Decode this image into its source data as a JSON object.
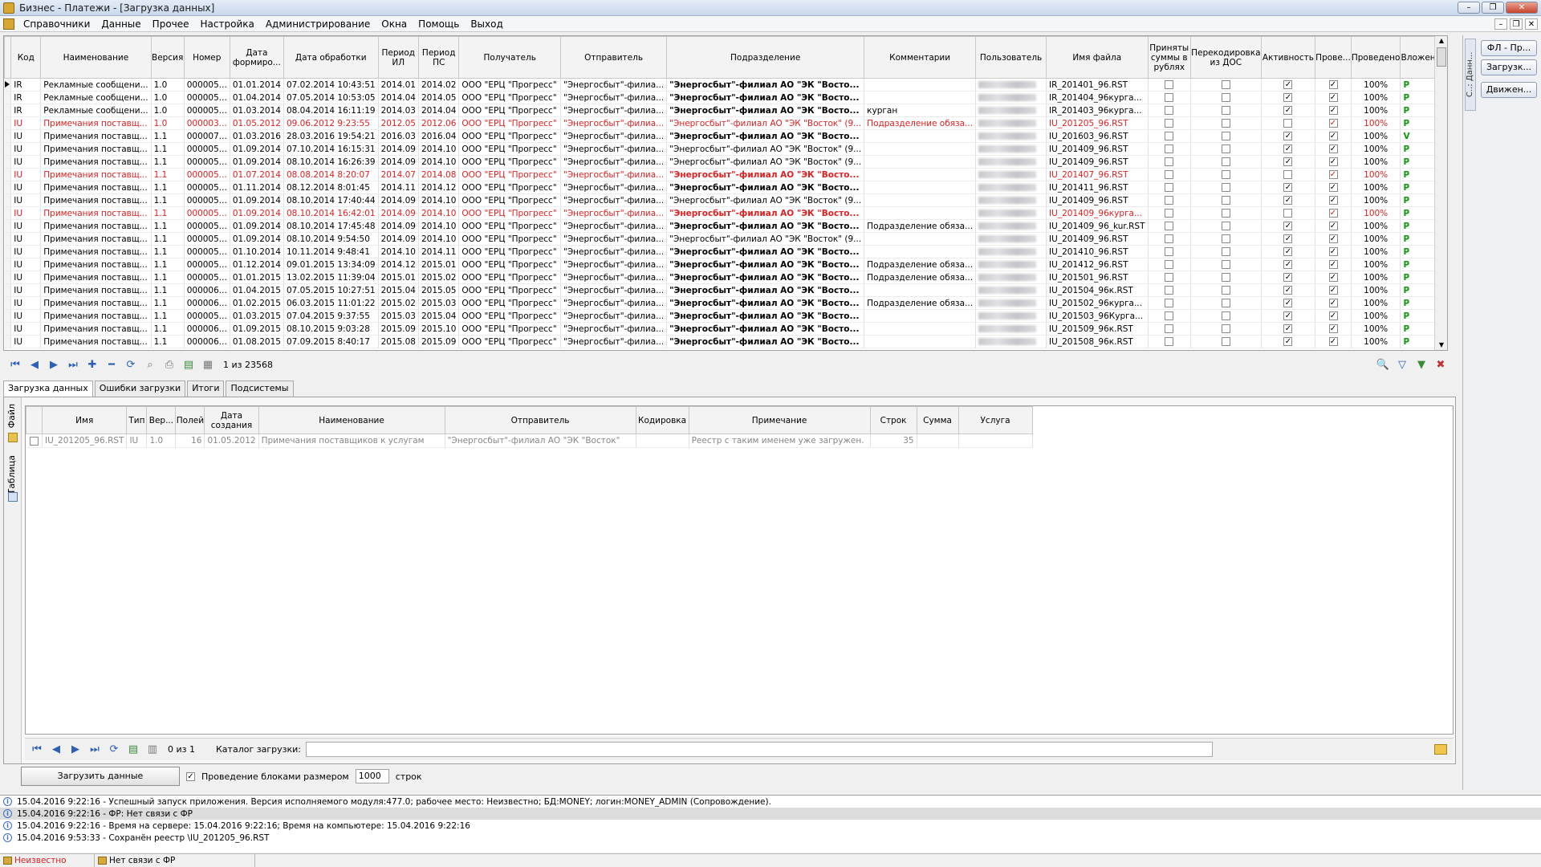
{
  "window": {
    "title": "Бизнес - Платежи - [Загрузка данных]",
    "min": "–",
    "restore": "❐",
    "close": "✕"
  },
  "menu": [
    "Справочники",
    "Данные",
    "Прочее",
    "Настройка",
    "Администрирование",
    "Окна",
    "Помощь",
    "Выход"
  ],
  "main_grid": {
    "columns": [
      "Код",
      "Наименование",
      "Версия",
      "Номер",
      "Дата формиро...",
      "Дата обработки",
      "Период ИЛ",
      "Период ПС",
      "Получатель",
      "Отправитель",
      "Подразделение",
      "Комментарии",
      "Пользователь",
      "Имя файла",
      "Приняты суммы в рублях",
      "Перекодировка из ДОС",
      "Активность",
      "Прове...",
      "Проведено",
      "Вложение"
    ],
    "rows": [
      {
        "red": false,
        "bold": true,
        "cells": [
          "IR",
          "Рекламные сообщени...",
          "1.0",
          "000005...",
          "01.01.2014",
          "07.02.2014 10:43:51",
          "2014.01",
          "2014.02",
          "ООО \"ЕРЦ \"Прогресс\"",
          "\"Энергосбыт\"-филиа...",
          "\"Энергосбыт\"-филиал АО \"ЭК \"Восто...",
          "",
          "",
          "IR_201401_96.RST",
          "✓",
          "✓",
          "100%",
          "P"
        ],
        "act": true
      },
      {
        "red": false,
        "bold": true,
        "cells": [
          "IR",
          "Рекламные сообщени...",
          "1.0",
          "000005...",
          "01.04.2014",
          "07.05.2014 10:53:05",
          "2014.04",
          "2014.05",
          "ООО \"ЕРЦ \"Прогресс\"",
          "\"Энергосбыт\"-филиа...",
          "\"Энергосбыт\"-филиал АО \"ЭК \"Восто...",
          "",
          "",
          "IR_201404_96курга...",
          "✓",
          "✓",
          "100%",
          "P"
        ]
      },
      {
        "red": false,
        "bold": true,
        "cells": [
          "IR",
          "Рекламные сообщени...",
          "1.0",
          "000005...",
          "01.03.2014",
          "08.04.2014 16:11:19",
          "2014.03",
          "2014.04",
          "ООО \"ЕРЦ \"Прогресс\"",
          "\"Энергосбыт\"-филиа...",
          "\"Энергосбыт\"-филиал АО \"ЭК \"Восто...",
          "курган",
          "",
          "IR_201403_96курга...",
          "✓",
          "✓",
          "100%",
          "P"
        ]
      },
      {
        "red": true,
        "bold": false,
        "cells": [
          "IU",
          "Примечания поставщ...",
          "1.0",
          "000003...",
          "01.05.2012",
          "09.06.2012 9:23:55",
          "2012.05",
          "2012.06",
          "ООО \"ЕРЦ \"Прогресс\"",
          "\"Энергосбыт\"-филиа...",
          "\"Энергосбыт\"-филиал АО \"ЭК \"Восток\" (9...",
          "Подразделение обяза...",
          "",
          "IU_201205_96.RST",
          "",
          "✓",
          "100%",
          "P"
        ]
      },
      {
        "red": false,
        "bold": true,
        "cells": [
          "IU",
          "Примечания поставщ...",
          "1.1",
          "000007...",
          "01.03.2016",
          "28.03.2016 19:54:21",
          "2016.03",
          "2016.04",
          "ООО \"ЕРЦ \"Прогресс\"",
          "\"Энергосбыт\"-филиа...",
          "\"Энергосбыт\"-филиал АО \"ЭК \"Восто...",
          "",
          "",
          "IU_201603_96.RST",
          "✓",
          "✓",
          "100%",
          "V"
        ]
      },
      {
        "red": false,
        "bold": false,
        "cells": [
          "IU",
          "Примечания поставщ...",
          "1.1",
          "000005...",
          "01.09.2014",
          "07.10.2014 16:15:31",
          "2014.09",
          "2014.10",
          "ООО \"ЕРЦ \"Прогресс\"",
          "\"Энергосбыт\"-филиа...",
          "\"Энергосбыт\"-филиал АО \"ЭК \"Восток\" (9...",
          "",
          "",
          "IU_201409_96.RST",
          "✓",
          "✓",
          "100%",
          "P"
        ]
      },
      {
        "red": false,
        "bold": false,
        "cells": [
          "IU",
          "Примечания поставщ...",
          "1.1",
          "000005...",
          "01.09.2014",
          "08.10.2014 16:26:39",
          "2014.09",
          "2014.10",
          "ООО \"ЕРЦ \"Прогресс\"",
          "\"Энергосбыт\"-филиа...",
          "\"Энергосбыт\"-филиал АО \"ЭК \"Восток\" (9...",
          "",
          "",
          "IU_201409_96.RST",
          "✓",
          "✓",
          "100%",
          "P"
        ]
      },
      {
        "red": true,
        "bold": true,
        "cells": [
          "IU",
          "Примечания поставщ...",
          "1.1",
          "000005...",
          "01.07.2014",
          "08.08.2014 8:20:07",
          "2014.07",
          "2014.08",
          "ООО \"ЕРЦ \"Прогресс\"",
          "\"Энергосбыт\"-филиа...",
          "\"Энергосбыт\"-филиал АО \"ЭК \"Восто...",
          "",
          "",
          "IU_201407_96.RST",
          "",
          "✓",
          "100%",
          "P"
        ]
      },
      {
        "red": false,
        "bold": true,
        "cells": [
          "IU",
          "Примечания поставщ...",
          "1.1",
          "000005...",
          "01.11.2014",
          "08.12.2014 8:01:45",
          "2014.11",
          "2014.12",
          "ООО \"ЕРЦ \"Прогресс\"",
          "\"Энергосбыт\"-филиа...",
          "\"Энергосбыт\"-филиал АО \"ЭК \"Восто...",
          "",
          "",
          "IU_201411_96.RST",
          "✓",
          "✓",
          "100%",
          "P"
        ]
      },
      {
        "red": false,
        "bold": false,
        "cells": [
          "IU",
          "Примечания поставщ...",
          "1.1",
          "000005...",
          "01.09.2014",
          "08.10.2014 17:40:44",
          "2014.09",
          "2014.10",
          "ООО \"ЕРЦ \"Прогресс\"",
          "\"Энергосбыт\"-филиа...",
          "\"Энергосбыт\"-филиал АО \"ЭК \"Восток\" (9...",
          "",
          "",
          "IU_201409_96.RST",
          "✓",
          "✓",
          "100%",
          "P"
        ]
      },
      {
        "red": true,
        "bold": true,
        "cells": [
          "IU",
          "Примечания поставщ...",
          "1.1",
          "000005...",
          "01.09.2014",
          "08.10.2014 16:42:01",
          "2014.09",
          "2014.10",
          "ООО \"ЕРЦ \"Прогресс\"",
          "\"Энергосбыт\"-филиа...",
          "\"Энергосбыт\"-филиал АО \"ЭК \"Восто...",
          "",
          "",
          "IU_201409_96курга...",
          "",
          "✓",
          "100%",
          "P"
        ]
      },
      {
        "red": false,
        "bold": true,
        "cells": [
          "IU",
          "Примечания поставщ...",
          "1.1",
          "000005...",
          "01.09.2014",
          "08.10.2014 17:45:48",
          "2014.09",
          "2014.10",
          "ООО \"ЕРЦ \"Прогресс\"",
          "\"Энергосбыт\"-филиа...",
          "\"Энергосбыт\"-филиал АО \"ЭК \"Восто...",
          "Подразделение обяза...",
          "",
          "IU_201409_96_kur.RST",
          "✓",
          "✓",
          "100%",
          "P"
        ]
      },
      {
        "red": false,
        "bold": false,
        "cells": [
          "IU",
          "Примечания поставщ...",
          "1.1",
          "000005...",
          "01.09.2014",
          "08.10.2014 9:54:50",
          "2014.09",
          "2014.10",
          "ООО \"ЕРЦ \"Прогресс\"",
          "\"Энергосбыт\"-филиа...",
          "\"Энергосбыт\"-филиал АО \"ЭК \"Восток\" (9...",
          "",
          "",
          "IU_201409_96.RST",
          "✓",
          "✓",
          "100%",
          "P"
        ]
      },
      {
        "red": false,
        "bold": true,
        "cells": [
          "IU",
          "Примечания поставщ...",
          "1.1",
          "000005...",
          "01.10.2014",
          "10.11.2014 9:48:41",
          "2014.10",
          "2014.11",
          "ООО \"ЕРЦ \"Прогресс\"",
          "\"Энергосбыт\"-филиа...",
          "\"Энергосбыт\"-филиал АО \"ЭК \"Восто...",
          "",
          "",
          "IU_201410_96.RST",
          "✓",
          "✓",
          "100%",
          "P"
        ]
      },
      {
        "red": false,
        "bold": true,
        "cells": [
          "IU",
          "Примечания поставщ...",
          "1.1",
          "000005...",
          "01.12.2014",
          "09.01.2015 13:34:09",
          "2014.12",
          "2015.01",
          "ООО \"ЕРЦ \"Прогресс\"",
          "\"Энергосбыт\"-филиа...",
          "\"Энергосбыт\"-филиал АО \"ЭК \"Восто...",
          "Подразделение обяза...",
          "",
          "IU_201412_96.RST",
          "✓",
          "✓",
          "100%",
          "P"
        ]
      },
      {
        "red": false,
        "bold": true,
        "cells": [
          "IU",
          "Примечания поставщ...",
          "1.1",
          "000005...",
          "01.01.2015",
          "13.02.2015 11:39:04",
          "2015.01",
          "2015.02",
          "ООО \"ЕРЦ \"Прогресс\"",
          "\"Энергосбыт\"-филиа...",
          "\"Энергосбыт\"-филиал АО \"ЭК \"Восто...",
          "Подразделение обяза...",
          "",
          "IU_201501_96.RST",
          "✓",
          "✓",
          "100%",
          "P"
        ]
      },
      {
        "red": false,
        "bold": true,
        "cells": [
          "IU",
          "Примечания поставщ...",
          "1.1",
          "000006...",
          "01.04.2015",
          "07.05.2015 10:27:51",
          "2015.04",
          "2015.05",
          "ООО \"ЕРЦ \"Прогресс\"",
          "\"Энергосбыт\"-филиа...",
          "\"Энергосбыт\"-филиал АО \"ЭК \"Восто...",
          "",
          "",
          "IU_201504_96к.RST",
          "✓",
          "✓",
          "100%",
          "P"
        ]
      },
      {
        "red": false,
        "bold": true,
        "cells": [
          "IU",
          "Примечания поставщ...",
          "1.1",
          "000006...",
          "01.02.2015",
          "06.03.2015 11:01:22",
          "2015.02",
          "2015.03",
          "ООО \"ЕРЦ \"Прогресс\"",
          "\"Энергосбыт\"-филиа...",
          "\"Энергосбыт\"-филиал АО \"ЭК \"Восто...",
          "Подразделение обяза...",
          "",
          "IU_201502_96курга...",
          "✓",
          "✓",
          "100%",
          "P"
        ]
      },
      {
        "red": false,
        "bold": true,
        "cells": [
          "IU",
          "Примечания поставщ...",
          "1.1",
          "000005...",
          "01.03.2015",
          "07.04.2015 9:37:55",
          "2015.03",
          "2015.04",
          "ООО \"ЕРЦ \"Прогресс\"",
          "\"Энергосбыт\"-филиа...",
          "\"Энергосбыт\"-филиал АО \"ЭК \"Восто...",
          "",
          "",
          "IU_201503_96Курга...",
          "✓",
          "✓",
          "100%",
          "P"
        ]
      },
      {
        "red": false,
        "bold": true,
        "cells": [
          "IU",
          "Примечания поставщ...",
          "1.1",
          "000006...",
          "01.09.2015",
          "08.10.2015 9:03:28",
          "2015.09",
          "2015.10",
          "ООО \"ЕРЦ \"Прогресс\"",
          "\"Энергосбыт\"-филиа...",
          "\"Энергосбыт\"-филиал АО \"ЭК \"Восто...",
          "",
          "",
          "IU_201509_96к.RST",
          "✓",
          "✓",
          "100%",
          "P"
        ]
      },
      {
        "red": false,
        "bold": true,
        "cells": [
          "IU",
          "Примечания поставщ...",
          "1.1",
          "000006...",
          "01.08.2015",
          "07.09.2015 8:40:17",
          "2015.08",
          "2015.09",
          "ООО \"ЕРЦ \"Прогресс\"",
          "\"Энергосбыт\"-филиа...",
          "\"Энергосбыт\"-филиал АО \"ЭК \"Восто...",
          "",
          "",
          "IU_201508_96к.RST",
          "✓",
          "✓",
          "100%",
          "P"
        ]
      }
    ]
  },
  "main_nav": {
    "position": "1 из 23568"
  },
  "right_panel": {
    "tab": "С..: Данн...",
    "buttons": [
      "ФЛ - Пр...",
      "Загрузк...",
      "Движен..."
    ]
  },
  "lower_tabs": [
    "Загрузка данных",
    "Ошибки загрузки",
    "Итоги",
    "Подсистемы"
  ],
  "side_tabs": [
    "Файл",
    "Таблица"
  ],
  "load_grid": {
    "columns": [
      "Имя",
      "Тип",
      "Вер...",
      "Полей",
      "Дата создания",
      "Наименование",
      "Отправитель",
      "Кодировка",
      "Примечание",
      "Строк",
      "Сумма",
      "Услуга"
    ],
    "rows": [
      [
        "IU_201205_96.RST",
        "IU",
        "1.0",
        "16",
        "01.05.2012",
        "Примечания поставщиков к услугам",
        "\"Энергосбыт\"-филиал АО \"ЭК \"Восток\"",
        "",
        "Реестр с таким именем уже загружен.",
        "35",
        "",
        ""
      ]
    ]
  },
  "load_nav": {
    "position": "0 из 1",
    "catalog_label": "Каталог загрузки:",
    "catalog_value": ""
  },
  "load_controls": {
    "button": "Загрузить данные",
    "blocks_label": "Проведение блоками размером",
    "block_size": "1000",
    "rows_label": "строк"
  },
  "log": [
    "15.04.2016 9:22:16 - Успешный запуск приложения. Версия исполняемого модуля:477.0; рабочее место: Неизвестно; БД:MONEY; логин:MONEY_ADMIN (Сопровождение).",
    "15.04.2016 9:22:16 - ФР: Нет связи с ФР",
    "15.04.2016 9:22:16 - Время на сервере: 15.04.2016 9:22:16; Время на компьютере: 15.04.2016 9:22:16",
    "15.04.2016 9:53:33 - Сохранён реестр \\IU_201205_96.RST"
  ],
  "status": {
    "workplace": "Неизвестно",
    "fr": "Нет связи с ФР"
  }
}
